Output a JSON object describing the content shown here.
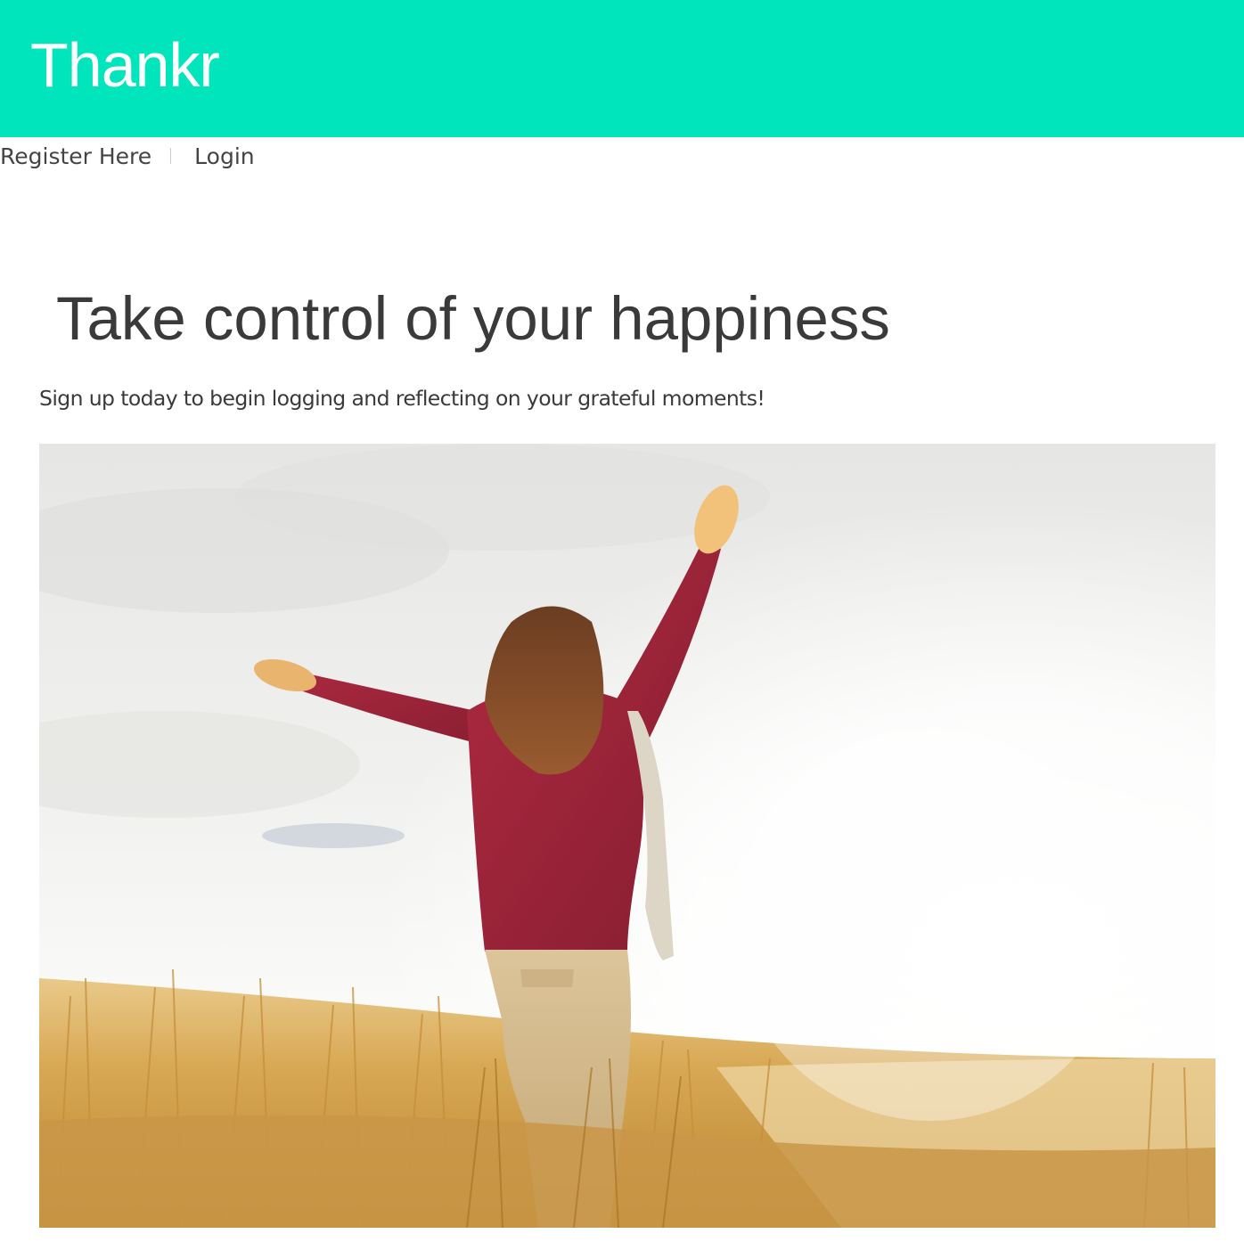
{
  "header": {
    "brand": "Thankr",
    "background_color": "#00e5bb"
  },
  "nav": {
    "register_label": "Register Here",
    "login_label": "Login"
  },
  "main": {
    "headline": "Take control of your happiness",
    "subtext": "Sign up today to begin logging and reflecting on your grateful moments!",
    "hero_image": {
      "alt": "woman-with-arms-raised-in-golden-field-icon"
    }
  }
}
